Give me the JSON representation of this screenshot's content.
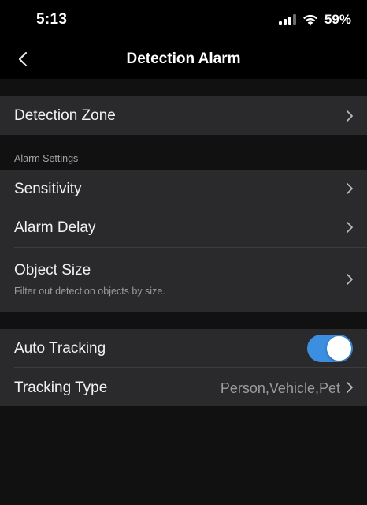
{
  "status_bar": {
    "time": "5:13",
    "battery": "59%",
    "icons": [
      "cellular-signal-icon",
      "wifi-icon"
    ]
  },
  "nav": {
    "title": "Detection Alarm",
    "back_icon": "chevron-left-icon"
  },
  "detection_zone": {
    "label": "Detection Zone"
  },
  "alarm_settings": {
    "header": "Alarm Settings",
    "sensitivity": "Sensitivity",
    "alarm_delay": "Alarm Delay",
    "object_size": "Object Size",
    "object_size_subtitle": "Filter out detection objects by size."
  },
  "tracking": {
    "auto_tracking": "Auto Tracking",
    "auto_tracking_on": true,
    "tracking_type": "Tracking Type",
    "tracking_type_value": "Person,Vehicle,Pet"
  },
  "colors": {
    "accent": "#3b8ee0",
    "row_bg": "#2a2a2c",
    "page_bg": "#111112"
  }
}
